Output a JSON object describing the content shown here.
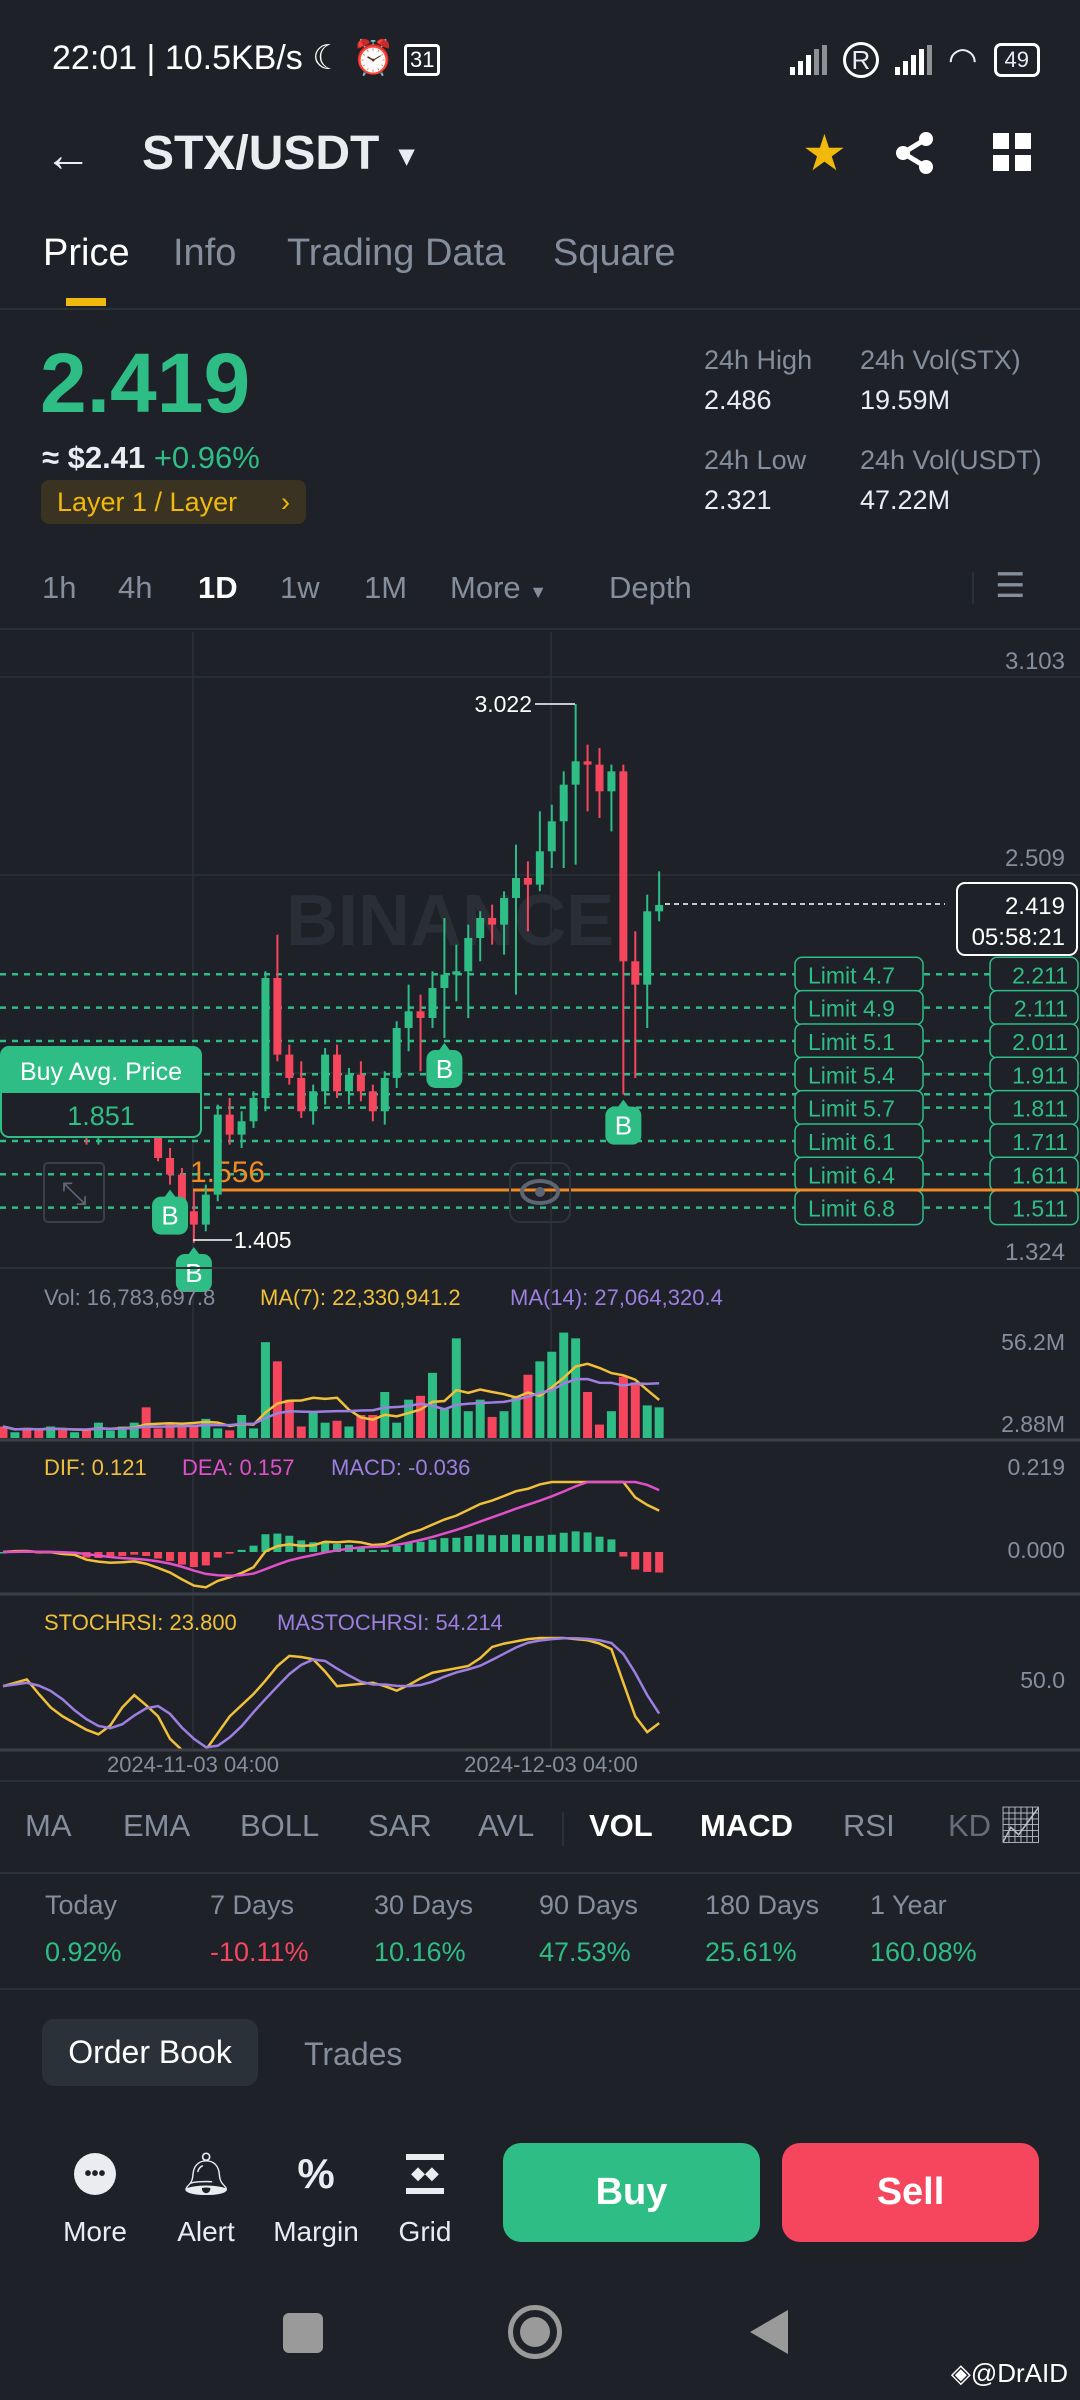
{
  "status_bar": {
    "time": "22:01",
    "speed": "10.5KB/s",
    "calendar_day": "31",
    "battery": "49"
  },
  "header": {
    "pair": "STX/USDT"
  },
  "tabs": [
    {
      "label": "Price"
    },
    {
      "label": "Info"
    },
    {
      "label": "Trading Data"
    },
    {
      "label": "Square"
    }
  ],
  "ticker": {
    "last_price": "2.419",
    "usd_approx": "≈ $2.41",
    "change": "+0.96%",
    "tag": "Layer 1 / Layer",
    "high_label": "24h High",
    "high": "2.486",
    "low_label": "24h Low",
    "low": "2.321",
    "vol_base_label": "24h Vol(STX)",
    "vol_base": "19.59M",
    "vol_quote_label": "24h Vol(USDT)",
    "vol_quote": "47.22M"
  },
  "timeframes": {
    "items": [
      "1h",
      "4h",
      "1D",
      "1w",
      "1M"
    ],
    "more": "More",
    "depth": "Depth",
    "selected": "1D"
  },
  "colors": {
    "up": "#2ebd85",
    "down": "#f6465d",
    "accent": "#f0b90b",
    "ma7": "#f0c03a",
    "ma14": "#9d7fe0",
    "dea": "#e050c8"
  },
  "chart_data": {
    "type": "candlestick",
    "watermark": "BINANCE",
    "price_axis": [
      "3.103",
      "2.509",
      "1.324"
    ],
    "price_range": [
      1.324,
      3.103
    ],
    "high_label": "3.022",
    "low_label": "1.405",
    "current_price": "2.419",
    "countdown": "05:58:21",
    "buy_avg": {
      "label": "Buy Avg. Price",
      "value": "1.851"
    },
    "orange_line": "1.556",
    "limits": [
      {
        "label": "Limit  4.7",
        "price": "2.211"
      },
      {
        "label": "Limit  4.9",
        "price": "2.111"
      },
      {
        "label": "Limit  5.1",
        "price": "2.011"
      },
      {
        "label": "Limit  5.4",
        "price": "1.911"
      },
      {
        "label": "Limit  5.7",
        "price": "1.811"
      },
      {
        "label": "Limit  6.1",
        "price": "1.711"
      },
      {
        "label": "Limit  6.4",
        "price": "1.611"
      },
      {
        "label": "Limit  6.8",
        "price": "1.511"
      }
    ],
    "buy_markers": [
      {
        "index": 14,
        "label": "B"
      },
      {
        "index": 16,
        "label": "B"
      },
      {
        "index": 37,
        "label": "B"
      },
      {
        "index": 52,
        "label": "B"
      }
    ],
    "candles": [
      [
        1.92,
        1.98,
        1.88,
        1.9
      ],
      [
        1.9,
        1.95,
        1.86,
        1.93
      ],
      [
        1.93,
        1.97,
        1.89,
        1.91
      ],
      [
        1.91,
        1.94,
        1.85,
        1.87
      ],
      [
        1.87,
        1.93,
        1.84,
        1.9
      ],
      [
        1.9,
        1.92,
        1.82,
        1.84
      ],
      [
        1.84,
        1.88,
        1.8,
        1.86
      ],
      [
        1.86,
        1.88,
        1.7,
        1.72
      ],
      [
        1.72,
        1.8,
        1.7,
        1.78
      ],
      [
        1.78,
        1.82,
        1.74,
        1.79
      ],
      [
        1.79,
        1.85,
        1.76,
        1.83
      ],
      [
        1.83,
        1.86,
        1.78,
        1.84
      ],
      [
        1.84,
        1.88,
        1.72,
        1.74
      ],
      [
        1.74,
        1.76,
        1.65,
        1.66
      ],
      [
        1.66,
        1.69,
        1.58,
        1.61
      ],
      [
        1.61,
        1.63,
        1.46,
        1.5
      ],
      [
        1.5,
        1.56,
        1.405,
        1.46
      ],
      [
        1.46,
        1.58,
        1.44,
        1.55
      ],
      [
        1.55,
        1.82,
        1.53,
        1.79
      ],
      [
        1.79,
        1.84,
        1.7,
        1.73
      ],
      [
        1.73,
        1.8,
        1.69,
        1.77
      ],
      [
        1.77,
        1.86,
        1.75,
        1.84
      ],
      [
        1.84,
        2.22,
        1.8,
        2.2
      ],
      [
        2.2,
        2.33,
        1.95,
        1.97
      ],
      [
        1.97,
        2.0,
        1.88,
        1.9
      ],
      [
        1.9,
        1.95,
        1.78,
        1.8
      ],
      [
        1.8,
        1.88,
        1.76,
        1.86
      ],
      [
        1.86,
        1.99,
        1.82,
        1.97
      ],
      [
        1.97,
        2.0,
        1.84,
        1.86
      ],
      [
        1.86,
        1.93,
        1.82,
        1.91
      ],
      [
        1.91,
        1.95,
        1.83,
        1.86
      ],
      [
        1.86,
        1.88,
        1.77,
        1.8
      ],
      [
        1.8,
        1.92,
        1.76,
        1.9
      ],
      [
        1.9,
        2.07,
        1.87,
        2.05
      ],
      [
        2.05,
        2.18,
        1.98,
        2.1
      ],
      [
        2.1,
        2.15,
        1.92,
        2.08
      ],
      [
        2.08,
        2.22,
        2.05,
        2.17
      ],
      [
        2.17,
        2.38,
        2.02,
        2.21
      ],
      [
        2.21,
        2.3,
        2.13,
        2.22
      ],
      [
        2.22,
        2.36,
        2.08,
        2.32
      ],
      [
        2.32,
        2.4,
        2.25,
        2.38
      ],
      [
        2.38,
        2.42,
        2.3,
        2.36
      ],
      [
        2.36,
        2.46,
        2.27,
        2.44
      ],
      [
        2.44,
        2.6,
        2.15,
        2.5
      ],
      [
        2.5,
        2.55,
        2.34,
        2.48
      ],
      [
        2.48,
        2.7,
        2.46,
        2.58
      ],
      [
        2.58,
        2.72,
        2.53,
        2.67
      ],
      [
        2.67,
        2.82,
        2.53,
        2.78
      ],
      [
        2.78,
        3.022,
        2.54,
        2.85
      ],
      [
        2.85,
        2.9,
        2.7,
        2.84
      ],
      [
        2.84,
        2.89,
        2.68,
        2.76
      ],
      [
        2.76,
        2.84,
        2.64,
        2.82
      ],
      [
        2.82,
        2.84,
        1.85,
        2.25
      ],
      [
        2.25,
        2.34,
        1.9,
        2.18
      ],
      [
        2.18,
        2.45,
        2.05,
        2.4
      ],
      [
        2.4,
        2.52,
        2.37,
        2.419
      ]
    ],
    "volume_millions": [
      6,
      3,
      5,
      4,
      6,
      4,
      3,
      5,
      8,
      4,
      6,
      8,
      16,
      5,
      7,
      6,
      7,
      10,
      5,
      4,
      12,
      5,
      50,
      40,
      20,
      6,
      14,
      8,
      9,
      6,
      12,
      12,
      24,
      8,
      20,
      22,
      34,
      15,
      52,
      14,
      20,
      11,
      14,
      22,
      33,
      40,
      45,
      55,
      52,
      24,
      7,
      14,
      32,
      29,
      17,
      16
    ],
    "stochrsi": [
      57,
      60,
      63,
      50,
      38,
      30,
      24,
      18,
      14,
      22,
      38,
      49,
      40,
      30,
      10,
      0,
      0,
      0,
      15,
      30,
      40,
      50,
      62,
      75,
      84,
      83,
      81,
      70,
      57,
      58,
      59,
      60,
      57,
      53,
      58,
      64,
      69,
      71,
      73,
      75,
      82,
      92,
      95,
      97,
      99,
      100,
      100,
      100,
      99,
      98,
      95,
      90,
      60,
      30,
      16,
      24
    ],
    "vol_labels": {
      "vol": "Vol: 16,783,697.8",
      "ma7": "MA(7): 22,330,941.2",
      "ma14": "MA(14): 27,064,320.4",
      "axis_top": "56.2M",
      "axis_bottom": "2.88M"
    },
    "macd_labels": {
      "dif": "DIF: 0.121",
      "dea": "DEA: 0.157",
      "macd": "MACD: -0.036",
      "axis_top": "0.219",
      "axis_zero": "0.000"
    },
    "stoch_labels": {
      "stoch": "STOCHRSI: 23.800",
      "ma": "MASTOCHRSI: 54.214",
      "axis_mid": "50.0"
    },
    "x_labels": [
      "2024-11-03 04:00",
      "2024-12-03 04:00"
    ]
  },
  "indicators": {
    "items": [
      "MA",
      "EMA",
      "BOLL",
      "SAR",
      "AVL",
      "VOL",
      "MACD",
      "RSI",
      "KD"
    ],
    "active": [
      "VOL",
      "MACD"
    ]
  },
  "performance": [
    {
      "label": "Today",
      "value": "0.92%"
    },
    {
      "label": "7 Days",
      "value": "-10.11%"
    },
    {
      "label": "30 Days",
      "value": "10.16%"
    },
    {
      "label": "90 Days",
      "value": "47.53%"
    },
    {
      "label": "180 Days",
      "value": "25.61%"
    },
    {
      "label": "1 Year",
      "value": "160.08%"
    }
  ],
  "book_tabs": [
    {
      "label": "Order Book"
    },
    {
      "label": "Trades"
    }
  ],
  "actions": [
    {
      "label": "More"
    },
    {
      "label": "Alert"
    },
    {
      "label": "Margin"
    },
    {
      "label": "Grid"
    }
  ],
  "buy_label": "Buy",
  "sell_label": "Sell",
  "watermark_user": "@DrAID"
}
